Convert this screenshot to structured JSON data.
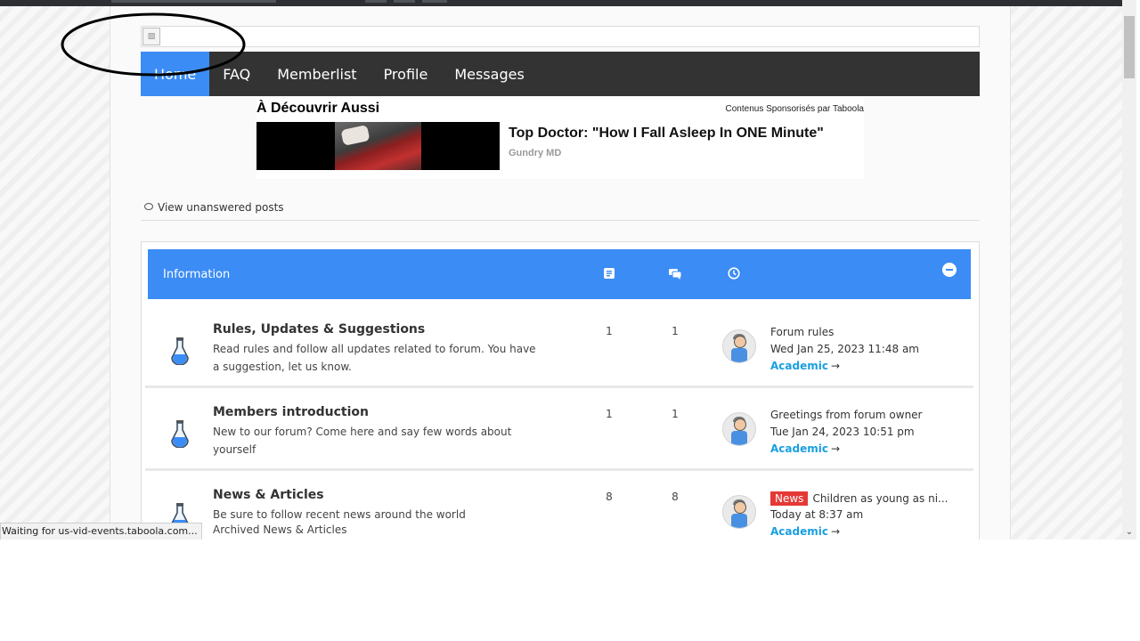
{
  "nav": {
    "items": [
      {
        "label": "Home",
        "active": true
      },
      {
        "label": "FAQ",
        "active": false
      },
      {
        "label": "Memberlist",
        "active": false
      },
      {
        "label": "Profile",
        "active": false
      },
      {
        "label": "Messages",
        "active": false
      }
    ]
  },
  "ad": {
    "title": "À Découvrir Aussi",
    "sponsor": "Contenus Sponsorisés par Taboola",
    "headline": "Top Doctor: \"How I Fall Asleep In ONE Minute\"",
    "source": "Gundry MD"
  },
  "links": {
    "unanswered": "View unanswered posts"
  },
  "forum": {
    "category": "Information",
    "header_icons": [
      "topics-icon",
      "posts-icon",
      "clock-icon",
      "collapse-icon"
    ],
    "accent": "#3b8cf5",
    "rows": [
      {
        "title": "Rules, Updates & Suggestions",
        "description": "Read rules and follow all updates related to forum. You have a suggestion, let us know.",
        "subforum": "",
        "topics": "1",
        "posts": "1",
        "badge": "",
        "last_post_title": "Forum rules",
        "last_post_date": "Wed Jan 25, 2023 11:48 am",
        "last_post_user": "Academic"
      },
      {
        "title": "Members introduction",
        "description": "New to our forum? Come here and say few words about yourself",
        "subforum": "",
        "topics": "1",
        "posts": "1",
        "badge": "",
        "last_post_title": "Greetings from forum owner",
        "last_post_date": "Tue Jan 24, 2023 10:51 pm",
        "last_post_user": "Academic"
      },
      {
        "title": "News & Articles",
        "description": "Be sure to follow recent news around the world",
        "subforum": "Archived News & Articles",
        "topics": "8",
        "posts": "8",
        "badge": "News",
        "last_post_title": "Children as young as ni...",
        "last_post_date": "Today at 8:37 am",
        "last_post_user": "Academic"
      }
    ]
  },
  "status_bar": "Waiting for us-vid-events.taboola.com..."
}
